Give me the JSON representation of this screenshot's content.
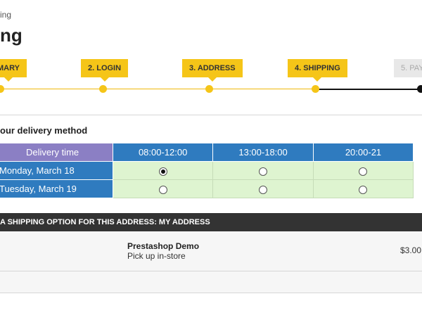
{
  "breadcrumb": "ing",
  "page_title": "ng",
  "steps": [
    {
      "label": "MARY"
    },
    {
      "label": "2. LOGIN"
    },
    {
      "label": "3. ADDRESS"
    },
    {
      "label": "4. SHIPPING"
    },
    {
      "label": "5. PAY"
    }
  ],
  "delivery": {
    "section_title": "our delivery method",
    "corner_header": "Delivery time",
    "time_slots": [
      "08:00-12:00",
      "13:00-18:00",
      "20:00-21"
    ],
    "rows": [
      {
        "date": "Monday, March 18",
        "selected_slot": 0
      },
      {
        "date": "Tuesday, March 19",
        "selected_slot": null
      }
    ]
  },
  "shipping": {
    "header": "A SHIPPING OPTION FOR THIS ADDRESS: MY ADDRESS",
    "carrier_name": "Prestashop Demo",
    "carrier_desc": "Pick up in-store",
    "price": "$3.00"
  },
  "colors": {
    "accent_yellow": "#f5c518",
    "table_blue": "#2f7bbf",
    "table_purple": "#8b7fc4",
    "slot_green": "#def4d0",
    "header_dark": "#333333"
  }
}
